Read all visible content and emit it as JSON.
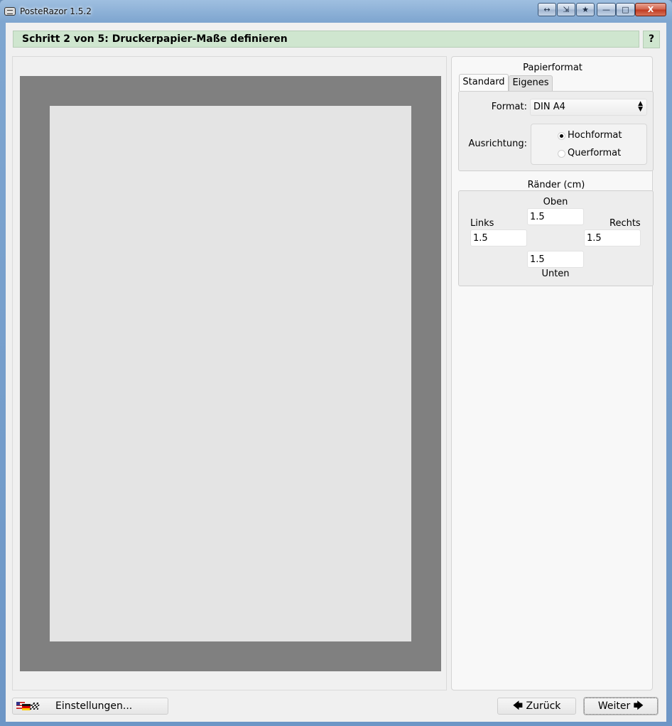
{
  "window": {
    "title": "PosteRazor 1.5.2",
    "buttons": [
      "↔",
      "⇲",
      "★",
      "—",
      "□",
      "X"
    ]
  },
  "header": {
    "step_title": "Schritt 2 von 5: Druckerpapier-Maße definieren",
    "help_label": "?"
  },
  "paper_format": {
    "section_label": "Papierformat",
    "tabs": [
      "Standard",
      "Eigenes"
    ],
    "active_tab": "Standard",
    "format_label": "Format:",
    "format_value": "DIN A4",
    "orientation_label": "Ausrichtung:",
    "orientation_options": [
      "Hochformat",
      "Querformat"
    ],
    "orientation_selected": "Hochformat"
  },
  "margins": {
    "section_label": "Ränder (cm)",
    "top_label": "Oben",
    "top_value": "1.5",
    "left_label": "Links",
    "left_value": "1.5",
    "right_label": "Rechts",
    "right_value": "1.5",
    "bottom_label": "Unten",
    "bottom_value": "1.5"
  },
  "footer": {
    "settings_label": "Einstellungen...",
    "back_label": "🡄 Zurück",
    "next_label": "Weiter 🡆"
  },
  "colors": {
    "header_bg": "#cfe6cf",
    "preview_border": "#808080",
    "paper": "#e4e4e4"
  }
}
